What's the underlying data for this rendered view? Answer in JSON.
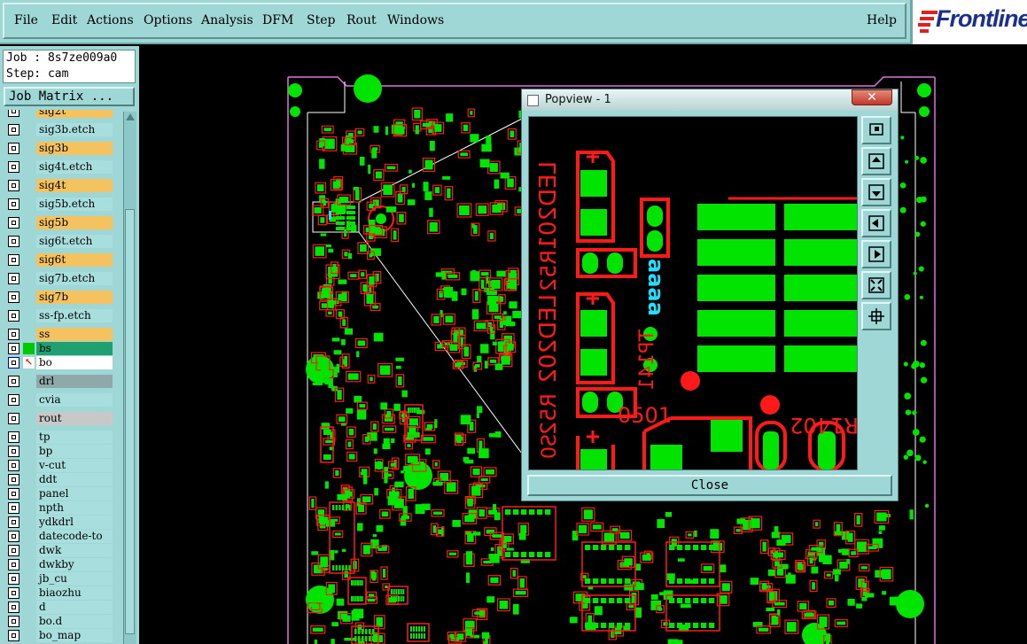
{
  "menu": {
    "items": [
      {
        "label": "File",
        "name": "menu-file"
      },
      {
        "label": "Edit",
        "name": "menu-edit"
      },
      {
        "label": "Actions",
        "name": "menu-actions"
      },
      {
        "label": "Options",
        "name": "menu-options"
      },
      {
        "label": "Analysis",
        "name": "menu-analysis"
      },
      {
        "label": "DFM",
        "name": "menu-dfm"
      },
      {
        "label": "Step",
        "name": "menu-step"
      },
      {
        "label": "Rout",
        "name": "menu-rout"
      },
      {
        "label": "Windows",
        "name": "menu-windows"
      }
    ],
    "help": "Help"
  },
  "logo": {
    "text": "Frontline",
    "color": "#1b2f8c",
    "mark_color": "#e02020"
  },
  "job": {
    "job_line": "Job : 8s7ze009a0",
    "step_line": "Step: cam"
  },
  "job_matrix_label": "Job Matrix ...",
  "layers": [
    {
      "name": "sig2t",
      "color": "#f5c260"
    },
    {
      "name": "sig3b.etch",
      "color": "#a9dede"
    },
    {
      "name": "sig3b",
      "color": "#f5c260"
    },
    {
      "name": "sig4t.etch",
      "color": "#a9dede"
    },
    {
      "name": "sig4t",
      "color": "#f5c260"
    },
    {
      "name": "sig5b.etch",
      "color": "#a9dede"
    },
    {
      "name": "sig5b",
      "color": "#f5c260"
    },
    {
      "name": "sig6t.etch",
      "color": "#a9dede"
    },
    {
      "name": "sig6t",
      "color": "#f5c260"
    },
    {
      "name": "sig7b.etch",
      "color": "#a9dede"
    },
    {
      "name": "sig7b",
      "color": "#f5c260"
    },
    {
      "name": "ss-fp.etch",
      "color": "#a9dede"
    },
    {
      "name": "ss",
      "color": "#f5c260"
    },
    {
      "name": "bs",
      "color": "#20a070",
      "indicator": "#00c800"
    },
    {
      "name": "bo",
      "color": "#ffffff",
      "active": true
    },
    {
      "name": "drl",
      "color": "#8fa8a8"
    },
    {
      "name": "cvia",
      "color": "#a9dede"
    },
    {
      "name": "rout",
      "color": "#c8c8c8"
    },
    {
      "name": "tp",
      "color": "#a9dede"
    },
    {
      "name": "bp",
      "color": "#a9dede"
    },
    {
      "name": "v-cut",
      "color": "#a9dede"
    },
    {
      "name": "ddt",
      "color": "#a9dede"
    },
    {
      "name": "panel",
      "color": "#a9dede"
    },
    {
      "name": "npth",
      "color": "#a9dede"
    },
    {
      "name": "ydkdrl",
      "color": "#a9dede"
    },
    {
      "name": "datecode-to",
      "color": "#a9dede"
    },
    {
      "name": "dwk",
      "color": "#a9dede"
    },
    {
      "name": "dwkby",
      "color": "#a9dede"
    },
    {
      "name": "jb_cu",
      "color": "#a9dede"
    },
    {
      "name": "biaozhu",
      "color": "#a9dede"
    },
    {
      "name": "d",
      "color": "#a9dede"
    },
    {
      "name": "bo.d",
      "color": "#a9dede"
    },
    {
      "name": "bo_map",
      "color": "#a9dede"
    }
  ],
  "popview": {
    "title": "Popview - 1",
    "close_x": "✕",
    "close_button": "Close",
    "tool_icons": [
      "zoom-fit-icon",
      "pan-up-icon",
      "pan-down-icon",
      "pan-left-icon",
      "pan-right-icon",
      "zoom-in-icon",
      "zoom-out-icon"
    ],
    "labels": {
      "led201": "LED201",
      "led202": "LED202",
      "r5a": "R52",
      "r5b": "R52",
      "date": "aaaa",
      "p": "R1402",
      "q": "0501",
      "tp": "TP141",
      "s0": "S0"
    }
  },
  "colors": {
    "pad": "#00e400",
    "silk": "#ff1a1a",
    "outline": "#e070e0",
    "ui": "#9fd6d6"
  }
}
